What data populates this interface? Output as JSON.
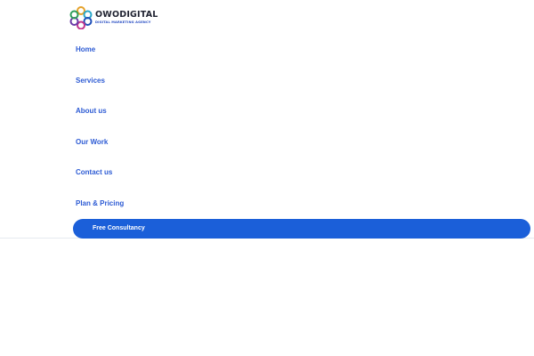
{
  "logo": {
    "name": "OWODIGITAL",
    "tagline": "DIGITAL MARKETING AGENCY",
    "colors": [
      "#e5a12a",
      "#2aa7c9",
      "#1f4fb8",
      "#c2368e",
      "#6a3aa8",
      "#2f9e5c"
    ]
  },
  "nav": {
    "items": [
      {
        "label": "Home"
      },
      {
        "label": "Services"
      },
      {
        "label": "About us"
      },
      {
        "label": "Our Work"
      },
      {
        "label": "Contact us"
      },
      {
        "label": "Plan & Pricing"
      }
    ]
  },
  "cta": {
    "label": "Free Consultancy"
  },
  "colors": {
    "link": "#2d5bd4",
    "cta_bg": "#1b5fd9",
    "divider": "#e6e9ef"
  }
}
